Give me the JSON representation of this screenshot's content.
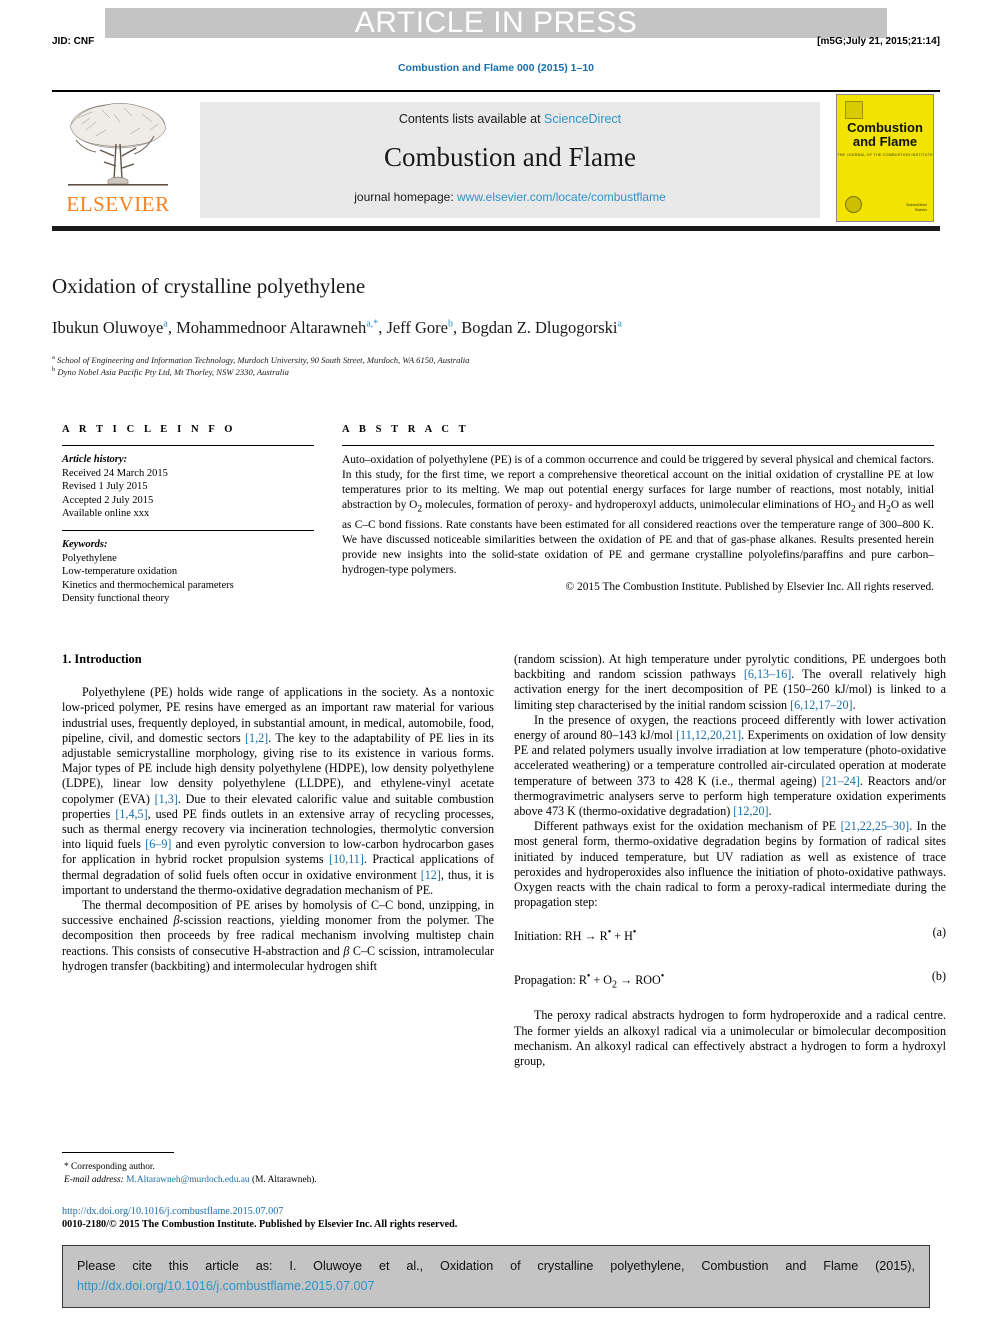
{
  "header": {
    "press_banner": "ARTICLE IN PRESS",
    "jid": "JID: CNF",
    "build_stamp": "[m5G;July 21, 2015;21:14]",
    "journal_reference": "Combustion and Flame 000 (2015) 1–10"
  },
  "masthead": {
    "contents_prefix": "Contents lists available at ",
    "contents_link": "ScienceDirect",
    "journal_title": "Combustion and Flame",
    "homepage_prefix": "journal homepage: ",
    "homepage_url": "www.elsevier.com/locate/combustflame",
    "publisher": "ELSEVIER",
    "cover_title_line1": "Combustion",
    "cover_title_line2": "and Flame",
    "cover_subtitle": "THE JOURNAL OF THE COMBUSTION INSTITUTE",
    "cover_footer_line1": "ScienceDirect",
    "cover_footer_line2": "Elsevier"
  },
  "article": {
    "title": "Oxidation of crystalline polyethylene",
    "authors_html": "Ibukun Oluwoye<sup>a</sup>, Mohammednoor Altarawneh<sup>a,*</sup>, Jeff Gore<sup>b</sup>, Bogdan Z. Dlugogorski<sup>a</sup>",
    "affiliation_a": "School of Engineering and Information Technology, Murdoch University, 90 South Street, Murdoch, WA 6150, Australia",
    "affiliation_b": "Dyno Nobel Asia Pacific Pty Ltd, Mt Thorley, NSW 2330, Australia",
    "affil_marker_a": "a",
    "affil_marker_b": "b"
  },
  "article_info": {
    "heading": "A R T I C L E    I N F O",
    "history_label": "Article history:",
    "history": [
      "Received 24 March 2015",
      "Revised 1 July 2015",
      "Accepted 2 July 2015",
      "Available online xxx"
    ],
    "keywords_label": "Keywords:",
    "keywords": [
      "Polyethylene",
      "Low-temperature oxidation",
      "Kinetics and thermochemical parameters",
      "Density functional theory"
    ]
  },
  "abstract": {
    "heading": "A B S T R A C T",
    "body_html": "Auto–oxidation of polyethylene (PE) is of a common occurrence and could be triggered by several physical and chemical factors. In this study, for the first time, we report a comprehensive theoretical account on the initial oxidation of crystalline PE at low temperatures prior to its melting. We map out potential energy surfaces for large number of reactions, most notably, initial abstraction by O<sub>2</sub> molecules, formation of peroxy- and hydroperoxyl adducts, unimolecular eliminations of HO<sub>2</sub> and H<sub>2</sub>O as well as C–C bond fissions. Rate constants have been estimated for all considered reactions over the temperature range of 300–800 K. We have discussed noticeable similarities between the oxidation of PE and that of gas-phase alkanes. Results presented herein provide new insights into the solid-state oxidation of PE and germane crystalline polyolefins/paraffins and pure carbon–hydrogen-type polymers.",
    "copyright": "© 2015 The Combustion Institute. Published by Elsevier Inc. All rights reserved."
  },
  "body": {
    "section_heading": "1. Introduction",
    "left_paragraphs_html": [
      "Polyethylene (PE) holds wide range of applications in the society. As a nontoxic low-priced polymer, PE resins have emerged as an important raw material for various industrial uses, frequently deployed, in substantial amount, in medical, automobile, food, pipeline, civil, and domestic sectors <span class=\"ref\">[1,2]</span>. The key to the adaptability of PE lies in its adjustable semicrystalline morphology, giving rise to its existence in various forms. Major types of PE include high density polyethylene (HDPE), low density polyethylene (LDPE), linear low density polyethylene (LLDPE), and ethylene-vinyl acetate copolymer (EVA) <span class=\"ref\">[1,3]</span>. Due to their elevated calorific value and suitable combustion properties <span class=\"ref\">[1,4,5]</span>, used PE finds outlets in an extensive array of recycling processes, such as thermal energy recovery via incineration technologies, thermolytic conversion into liquid fuels <span class=\"ref\">[6–9]</span> and even pyrolytic conversion to low-carbon hydrocarbon gases for application in hybrid rocket propulsion systems <span class=\"ref\">[10,11]</span>. Practical applications of thermal degradation of solid fuels often occur in oxidative environment <span class=\"ref\">[12]</span>, thus, it is important to understand the thermo-oxidative degradation mechanism of PE.",
      "The thermal decomposition of PE arises by homolysis of C–C bond, unzipping, in successive enchained <i>β</i>-scission reactions, yielding monomer from the polymer. The decomposition then proceeds by free radical mechanism involving multistep chain reactions. This consists of consecutive H-abstraction and <i>β</i> C–C scission, intramolecular hydrogen transfer (backbiting) and intermolecular hydrogen shift"
    ],
    "right_paragraphs_html": [
      "(random scission). At high temperature under pyrolytic conditions, PE undergoes both backbiting and random scission pathways <span class=\"ref\">[6,13–16]</span>. The overall relatively high activation energy for the inert decomposition of PE (150–260 kJ/mol) is linked to a limiting step characterised by the initial random scission <span class=\"ref\">[6,12,17–20]</span>.",
      "In the presence of oxygen, the reactions proceed differently with lower activation energy of around 80–143 kJ/mol <span class=\"ref\">[11,12,20,21]</span>. Experiments on oxidation of low density PE and related polymers usually involve irradiation at low temperature (photo-oxidative accelerated weathering) or a temperature controlled air-circulated operation at moderate temperature of between 373 to 428 K (i.e., thermal ageing) <span class=\"ref\">[21–24]</span>. Reactors and/or thermogravimetric analysers serve to perform high temperature oxidation experiments above 473 K (thermo-oxidative degradation) <span class=\"ref\">[12,20]</span>.",
      "Different pathways exist for the oxidation mechanism of PE <span class=\"ref\">[21,22,25–30]</span>. In the most general form, thermo-oxidative degradation begins by formation of radical sites initiated by induced temperature, but UV radiation as well as existence of trace peroxides and hydroperoxides also influence the initiation of photo-oxidative pathways. Oxygen reacts with the chain radical to form a peroxy-radical intermediate during the propagation step:"
    ],
    "equations": [
      {
        "text_html": "Initiation: RH → R<sup>•</sup> + H<sup>•</sup>",
        "label": "(a)"
      },
      {
        "text_html": "Propagation: R<sup>•</sup> + O<sub>2</sub> → ROO<sup>•</sup>",
        "label": "(b)"
      }
    ],
    "right_paragraph_after_eq_html": "The peroxy radical abstracts hydrogen to form hydroperoxide and a radical centre. The former yields an alkoxyl radical via a unimolecular or bimolecular decomposition mechanism. An alkoxyl radical can effectively abstract a hydrogen to form a hydroxyl group,"
  },
  "footnote": {
    "corresponding": "* Corresponding author.",
    "email_label": "E-mail address:",
    "email": "M.Altarawneh@murdoch.edu.au",
    "email_owner": "(M. Altarawneh).",
    "doi_url": "http://dx.doi.org/10.1016/j.combustflame.2015.07.007",
    "issn_line": "0010-2180/© 2015 The Combustion Institute. Published by Elsevier Inc. All rights reserved."
  },
  "cite_box": {
    "text": "Please cite this article as: I. Oluwoye et al., Oxidation of crystalline polyethylene, Combustion and Flame (2015),",
    "doi": "http://dx.doi.org/10.1016/j.combustflame.2015.07.007"
  },
  "colors": {
    "link_blue": "#1a6ea8",
    "sciencedirect_blue": "#2e94c8",
    "elsevier_orange": "#f58220",
    "banner_grey": "#c4c4c4",
    "masthead_grey": "#e9e9e9",
    "cover_yellow": "#f2e400"
  }
}
